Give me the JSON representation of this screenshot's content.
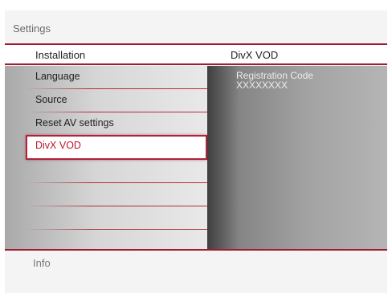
{
  "window_title": "Settings",
  "header": {
    "left_label": "Installation",
    "right_label": "DivX VOD"
  },
  "menu": {
    "items": [
      {
        "label": "Language"
      },
      {
        "label": "Source"
      },
      {
        "label": "Reset AV settings"
      },
      {
        "label": "DivX VOD",
        "selected": true
      },
      {
        "label": ""
      },
      {
        "label": ""
      },
      {
        "label": ""
      }
    ]
  },
  "detail": {
    "label": "Registration Code",
    "value": "XXXXXXXX"
  },
  "footer": {
    "info_label": "Info"
  },
  "colors": {
    "accent": "#a01c2e",
    "selected_text": "#c0142c"
  }
}
